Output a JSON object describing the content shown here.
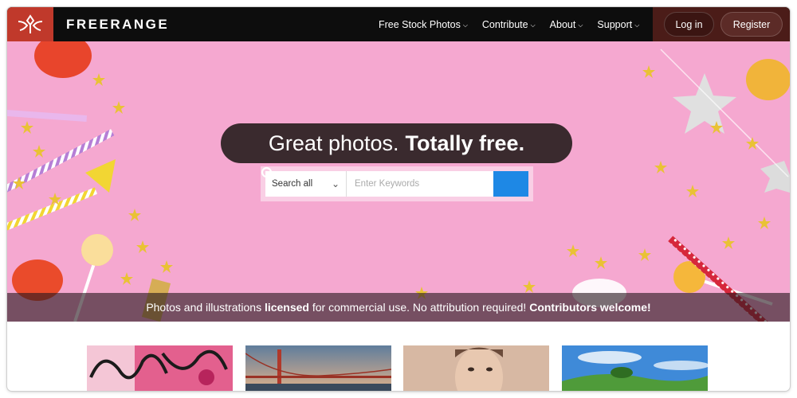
{
  "header": {
    "brand": "FREERANGE",
    "nav": [
      {
        "label": "Free Stock Photos"
      },
      {
        "label": "Contribute"
      },
      {
        "label": "About"
      },
      {
        "label": "Support"
      }
    ],
    "login_label": "Log in",
    "register_label": "Register"
  },
  "hero": {
    "headline_regular": "Great photos.",
    "headline_bold": "Totally free.",
    "search": {
      "scope_value": "Search all",
      "keywords_placeholder": "Enter Keywords"
    },
    "tagline": {
      "part1": "Photos and illustrations ",
      "part2": "licensed",
      "part3": " for commercial use. No attribution required! ",
      "part4": "Contributors welcome!"
    }
  },
  "colors": {
    "header_bg": "#0d0d0d",
    "logo_bg": "#c0392b",
    "auth_bg": "#4b1c18",
    "hero_bg": "#f5a8d0",
    "search_button": "#1e88e5"
  }
}
